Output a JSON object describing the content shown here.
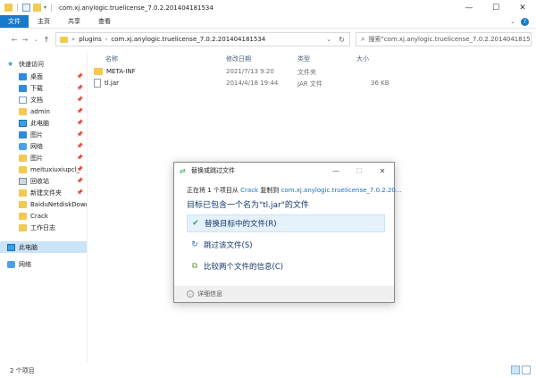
{
  "window": {
    "title": "com.xj.anylogic.truelicense_7.0.2.201404181534",
    "minimize": "—",
    "maximize": "☐",
    "close": "✕"
  },
  "ribbon": {
    "tabs": [
      "文件",
      "主页",
      "共享",
      "查看"
    ]
  },
  "address": {
    "prefix": "«",
    "crumbs": [
      "plugins",
      "com.xj.anylogic.truelicense_7.0.2.201404181534"
    ],
    "search_placeholder": "搜索\"com.xj.anylogic.truelicense_7.0.2.201404181515...\""
  },
  "sidebar": {
    "items": [
      {
        "label": "快速访问",
        "icon": "star-icon",
        "pinned": false
      },
      {
        "label": "桌面",
        "icon": "desktop-icon",
        "pinned": true
      },
      {
        "label": "下载",
        "icon": "download-icon",
        "pinned": true
      },
      {
        "label": "文档",
        "icon": "document-icon",
        "pinned": true
      },
      {
        "label": "admin",
        "icon": "folder-icon",
        "pinned": true
      },
      {
        "label": "此电脑",
        "icon": "pc-icon",
        "pinned": true
      },
      {
        "label": "图片",
        "icon": "pictures-icon",
        "pinned": true
      },
      {
        "label": "网络",
        "icon": "network-icon",
        "pinned": true
      },
      {
        "label": "图片",
        "icon": "folder-icon",
        "pinned": true
      },
      {
        "label": "meituxiuxiupcl_",
        "icon": "folder-icon",
        "pinned": true
      },
      {
        "label": "回收站",
        "icon": "recycle-bin-icon",
        "pinned": true
      },
      {
        "label": "新建文件夹",
        "icon": "folder-icon",
        "pinned": true
      },
      {
        "label": "BaiduNetdiskDown",
        "icon": "folder-icon",
        "pinned": false
      },
      {
        "label": "Crack",
        "icon": "folder-icon",
        "pinned": false
      },
      {
        "label": "工作日志",
        "icon": "folder-icon",
        "pinned": false
      },
      {
        "label": "此电脑",
        "icon": "pc-icon",
        "pinned": false,
        "selected": true
      },
      {
        "label": "网络",
        "icon": "network-icon",
        "pinned": false
      }
    ]
  },
  "files": {
    "columns": [
      "名称",
      "修改日期",
      "类型",
      "大小"
    ],
    "rows": [
      {
        "name": "META-INF",
        "date": "2021/7/13 9:20",
        "type": "文件夹",
        "size": "",
        "icon": "folder-icon"
      },
      {
        "name": "tl.jar",
        "date": "2014/4/18 19:44",
        "type": "JAR 文件",
        "size": "36 KB",
        "icon": "jar-file-icon"
      }
    ]
  },
  "status": {
    "count": "2 个项目"
  },
  "dialog": {
    "title": "替换或跳过文件",
    "line1_a": "正在将 1 个项目从 ",
    "line1_src": "Crack",
    "line1_b": " 复制到 ",
    "line1_dst": "com.xj.anylogic.truelicense_7.0.2.20...",
    "line2": "目标已包含一个名为\"tl.jar\"的文件",
    "options": [
      {
        "label": "替换目标中的文件(R)",
        "icon": "check-icon"
      },
      {
        "label": "跳过该文件(S)",
        "icon": "skip-icon"
      },
      {
        "label": "比较两个文件的信息(C)",
        "icon": "compare-icon"
      }
    ],
    "details": "详细信息"
  }
}
